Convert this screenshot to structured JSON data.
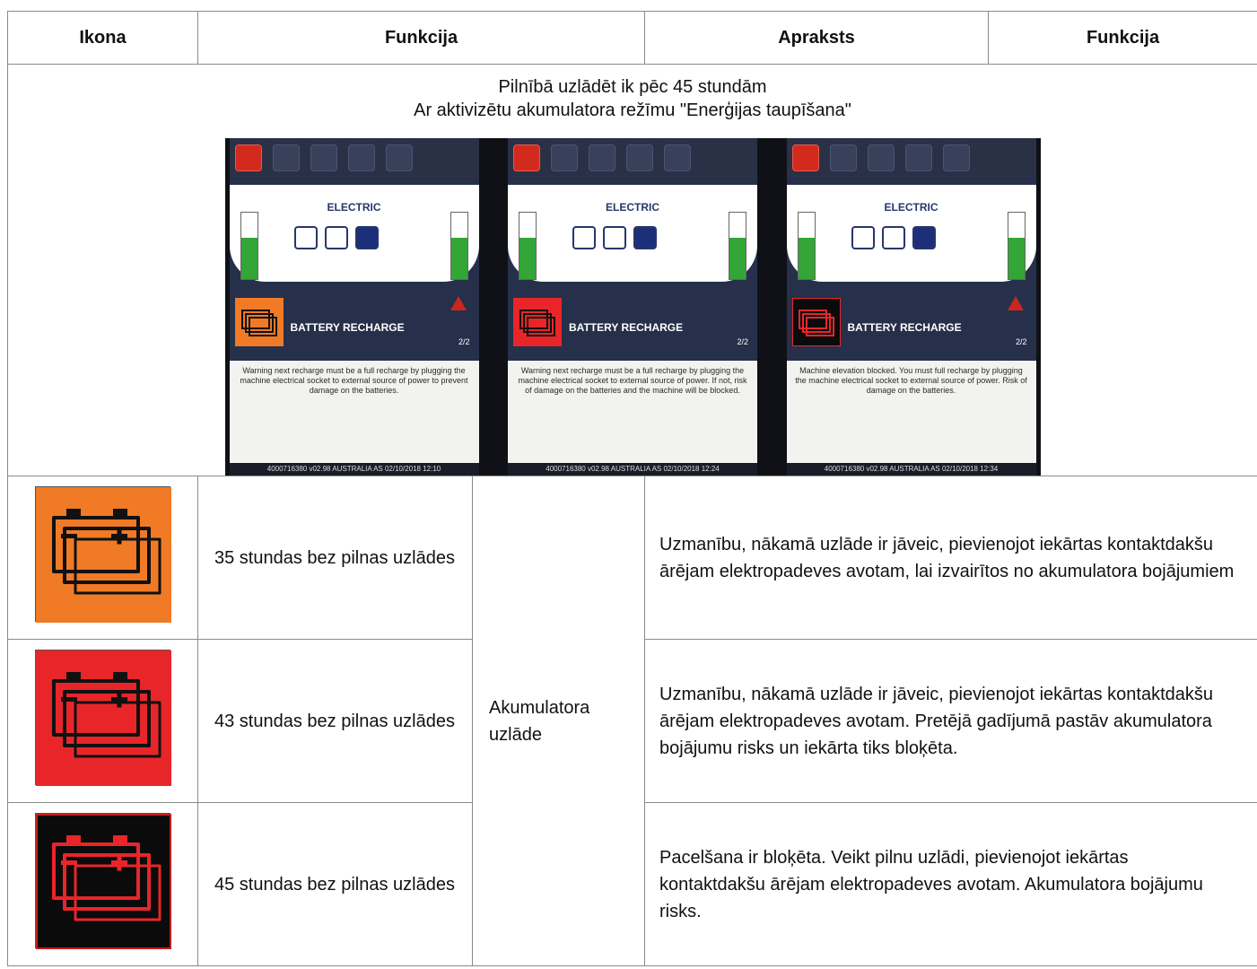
{
  "header": {
    "col1": "Ikona",
    "col2": "Funkcija",
    "col3": "Apraksts",
    "col4": "Funkcija"
  },
  "intro": {
    "line1": "Pilnībā uzlādēt ik pēc  45 stundām",
    "line2": "Ar aktivizētu akumulatora režīmu \"Enerģijas taupīšana\""
  },
  "screens": [
    {
      "title": "ELECTRIC",
      "alert_label": "BATTERY RECHARGE",
      "page": "2/2",
      "message": "Warning next recharge must be a full recharge by plugging the machine electrical socket to external source of power to prevent damage on the batteries.",
      "footer": "4000716380 v02.98 AUSTRALIA AS 02/10/2018 12:10",
      "icon_color": "#f07a26"
    },
    {
      "title": "ELECTRIC",
      "alert_label": "BATTERY RECHARGE",
      "page": "2/2",
      "message": "Warning next recharge must be a full recharge by plugging the machine electrical socket to external source of power. If not, risk of damage on the batteries and the machine will be blocked.",
      "footer": "4000716380 v02.98 AUSTRALIA AS 02/10/2018 12:24",
      "icon_color": "#e8262a"
    },
    {
      "title": "ELECTRIC",
      "alert_label": "BATTERY RECHARGE",
      "page": "2/2",
      "message": "Machine elevation blocked. You must full recharge by plugging the machine electrical socket to external source of power. Risk of damage on the batteries.",
      "footer": "4000716380 v02.98 AUSTRALIA AS 02/10/2018 12:34",
      "icon_color": "#0b0b0b"
    }
  ],
  "rows": [
    {
      "icon": "battery-orange-icon",
      "bg": "#f07a26",
      "fg": "#111111",
      "function": " 35 stundas bez pilnas uzlādes",
      "description": "Uzmanību, nākamā uzlāde ir jāveic, pievienojot iekārtas kontaktdakšu ārējam elektropadeves avotam, lai izvairītos no akumulatora bojājumiem"
    },
    {
      "icon": "battery-red-icon",
      "bg": "#e8262a",
      "fg": "#111111",
      "function": " 43 stundas bez pilnas uzlādes",
      "description": "Uzmanību, nākamā uzlāde ir jāveic, pievienojot iekārtas kontaktdakšu ārējam elektropadeves avotam. Pretējā gadījumā pastāv akumulatora bojājumu risks un iekārta tiks bloķēta."
    },
    {
      "icon": "battery-black-icon",
      "bg": "#0b0b0b",
      "fg": "#e8262a",
      "function": " 45 stundas bez pilnas uzlādes",
      "description": "Pacelšana ir bloķēta. Veikt pilnu uzlādi, pievienojot iekārtas kontaktdakšu ārējam elektropadeves avotam. Akumulatora bojājumu risks."
    }
  ],
  "group_label": "Akumulatora uzlāde"
}
